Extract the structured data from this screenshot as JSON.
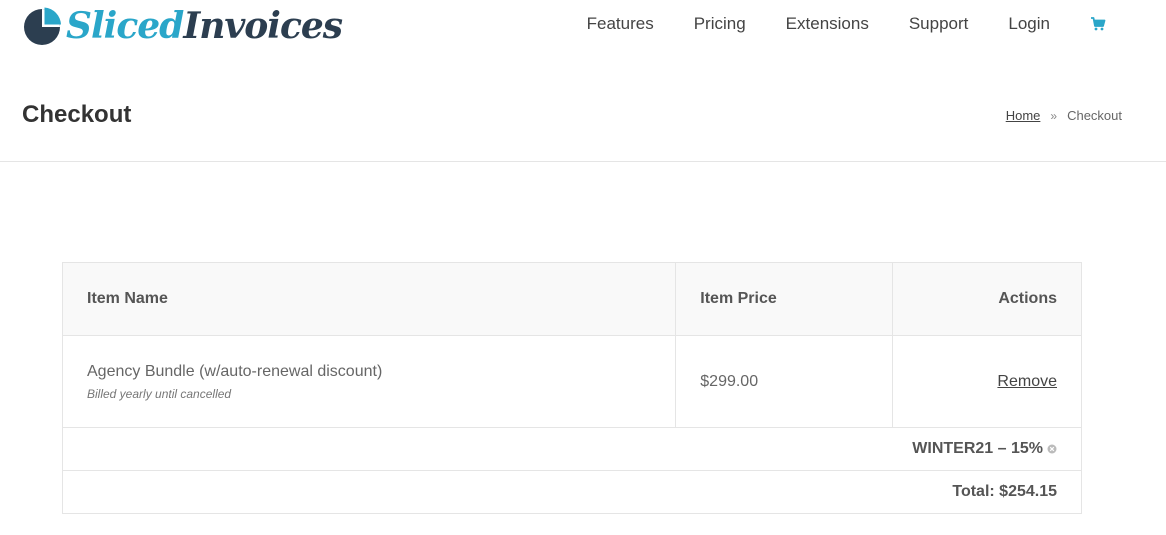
{
  "brand": {
    "name_part1": "Sliced",
    "name_part2": "Invoices",
    "accent_color": "#2aa6c9",
    "dark_color": "#2c3e50"
  },
  "nav": {
    "items": [
      {
        "label": "Features"
      },
      {
        "label": "Pricing"
      },
      {
        "label": "Extensions"
      },
      {
        "label": "Support"
      },
      {
        "label": "Login"
      }
    ],
    "cart_icon": "shopping-cart-icon"
  },
  "page": {
    "title": "Checkout",
    "breadcrumb": {
      "home": "Home",
      "separator": "»",
      "current": "Checkout"
    }
  },
  "cart": {
    "headers": {
      "name": "Item Name",
      "price": "Item Price",
      "actions": "Actions"
    },
    "items": [
      {
        "name": "Agency Bundle (w/auto-renewal discount)",
        "note": "Billed yearly until cancelled",
        "price": "$299.00",
        "action": "Remove"
      }
    ],
    "discount": {
      "label": "WINTER21 – 15%",
      "remove_icon": "remove-circle-icon"
    },
    "total": "Total: $254.15"
  }
}
